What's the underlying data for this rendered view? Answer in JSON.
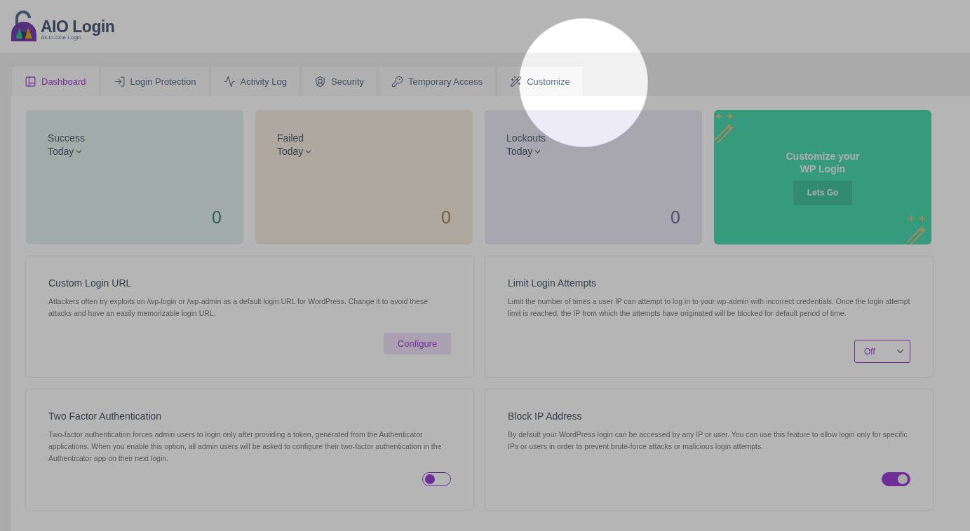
{
  "brand": {
    "title": "AIO Login",
    "subtitle": "All-In-One Login"
  },
  "tabs": [
    {
      "label": "Dashboard",
      "selected": true
    },
    {
      "label": "Login Protection",
      "selected": false
    },
    {
      "label": "Activity Log",
      "selected": false
    },
    {
      "label": "Security",
      "selected": false
    },
    {
      "label": "Temporary Access",
      "selected": false
    },
    {
      "label": "Customize",
      "selected": false
    }
  ],
  "stats": [
    {
      "title": "Success",
      "period": "Today",
      "value": "0"
    },
    {
      "title": "Failed",
      "period": "Today",
      "value": "0"
    },
    {
      "title": "Lockouts",
      "period": "Today",
      "value": "0"
    }
  ],
  "promo": {
    "title": "Customize your WP Login",
    "button": "Lets Go"
  },
  "features": [
    {
      "title": "Custom Login URL",
      "description": "Attackers often try exploits on /wp-login or /wp-admin as a default login URL for WordPress. Change it to avoid these attacks and have an easily memorizable login URL.",
      "kind": "button",
      "action": "Configure"
    },
    {
      "title": "Limit Login Attempts",
      "description": "Limit the number of times a user IP can attempt to log in to your wp-admin with incorrect credentials. Once the login attempt limit is reached, the IP from which the attempts have originated will be blocked for default period of time.",
      "kind": "select",
      "value": "Off"
    },
    {
      "title": "Two Factor Authentication",
      "description": "Two-factor authentication forces admin users to login only after providing a token, generated from the Authenticator applications. When you enable this option, all admin users will be asked to configure their two-factor authentication in the Authenticator app on their next login.",
      "kind": "toggle",
      "on": false
    },
    {
      "title": "Block IP Address",
      "description": "By default your WordPress login can be accessed by any IP or user. You can use this feature to allow login only for specific IPs or users in order to prevent brute-force attacks or malicious login attempts.",
      "kind": "toggle",
      "on": true
    }
  ]
}
